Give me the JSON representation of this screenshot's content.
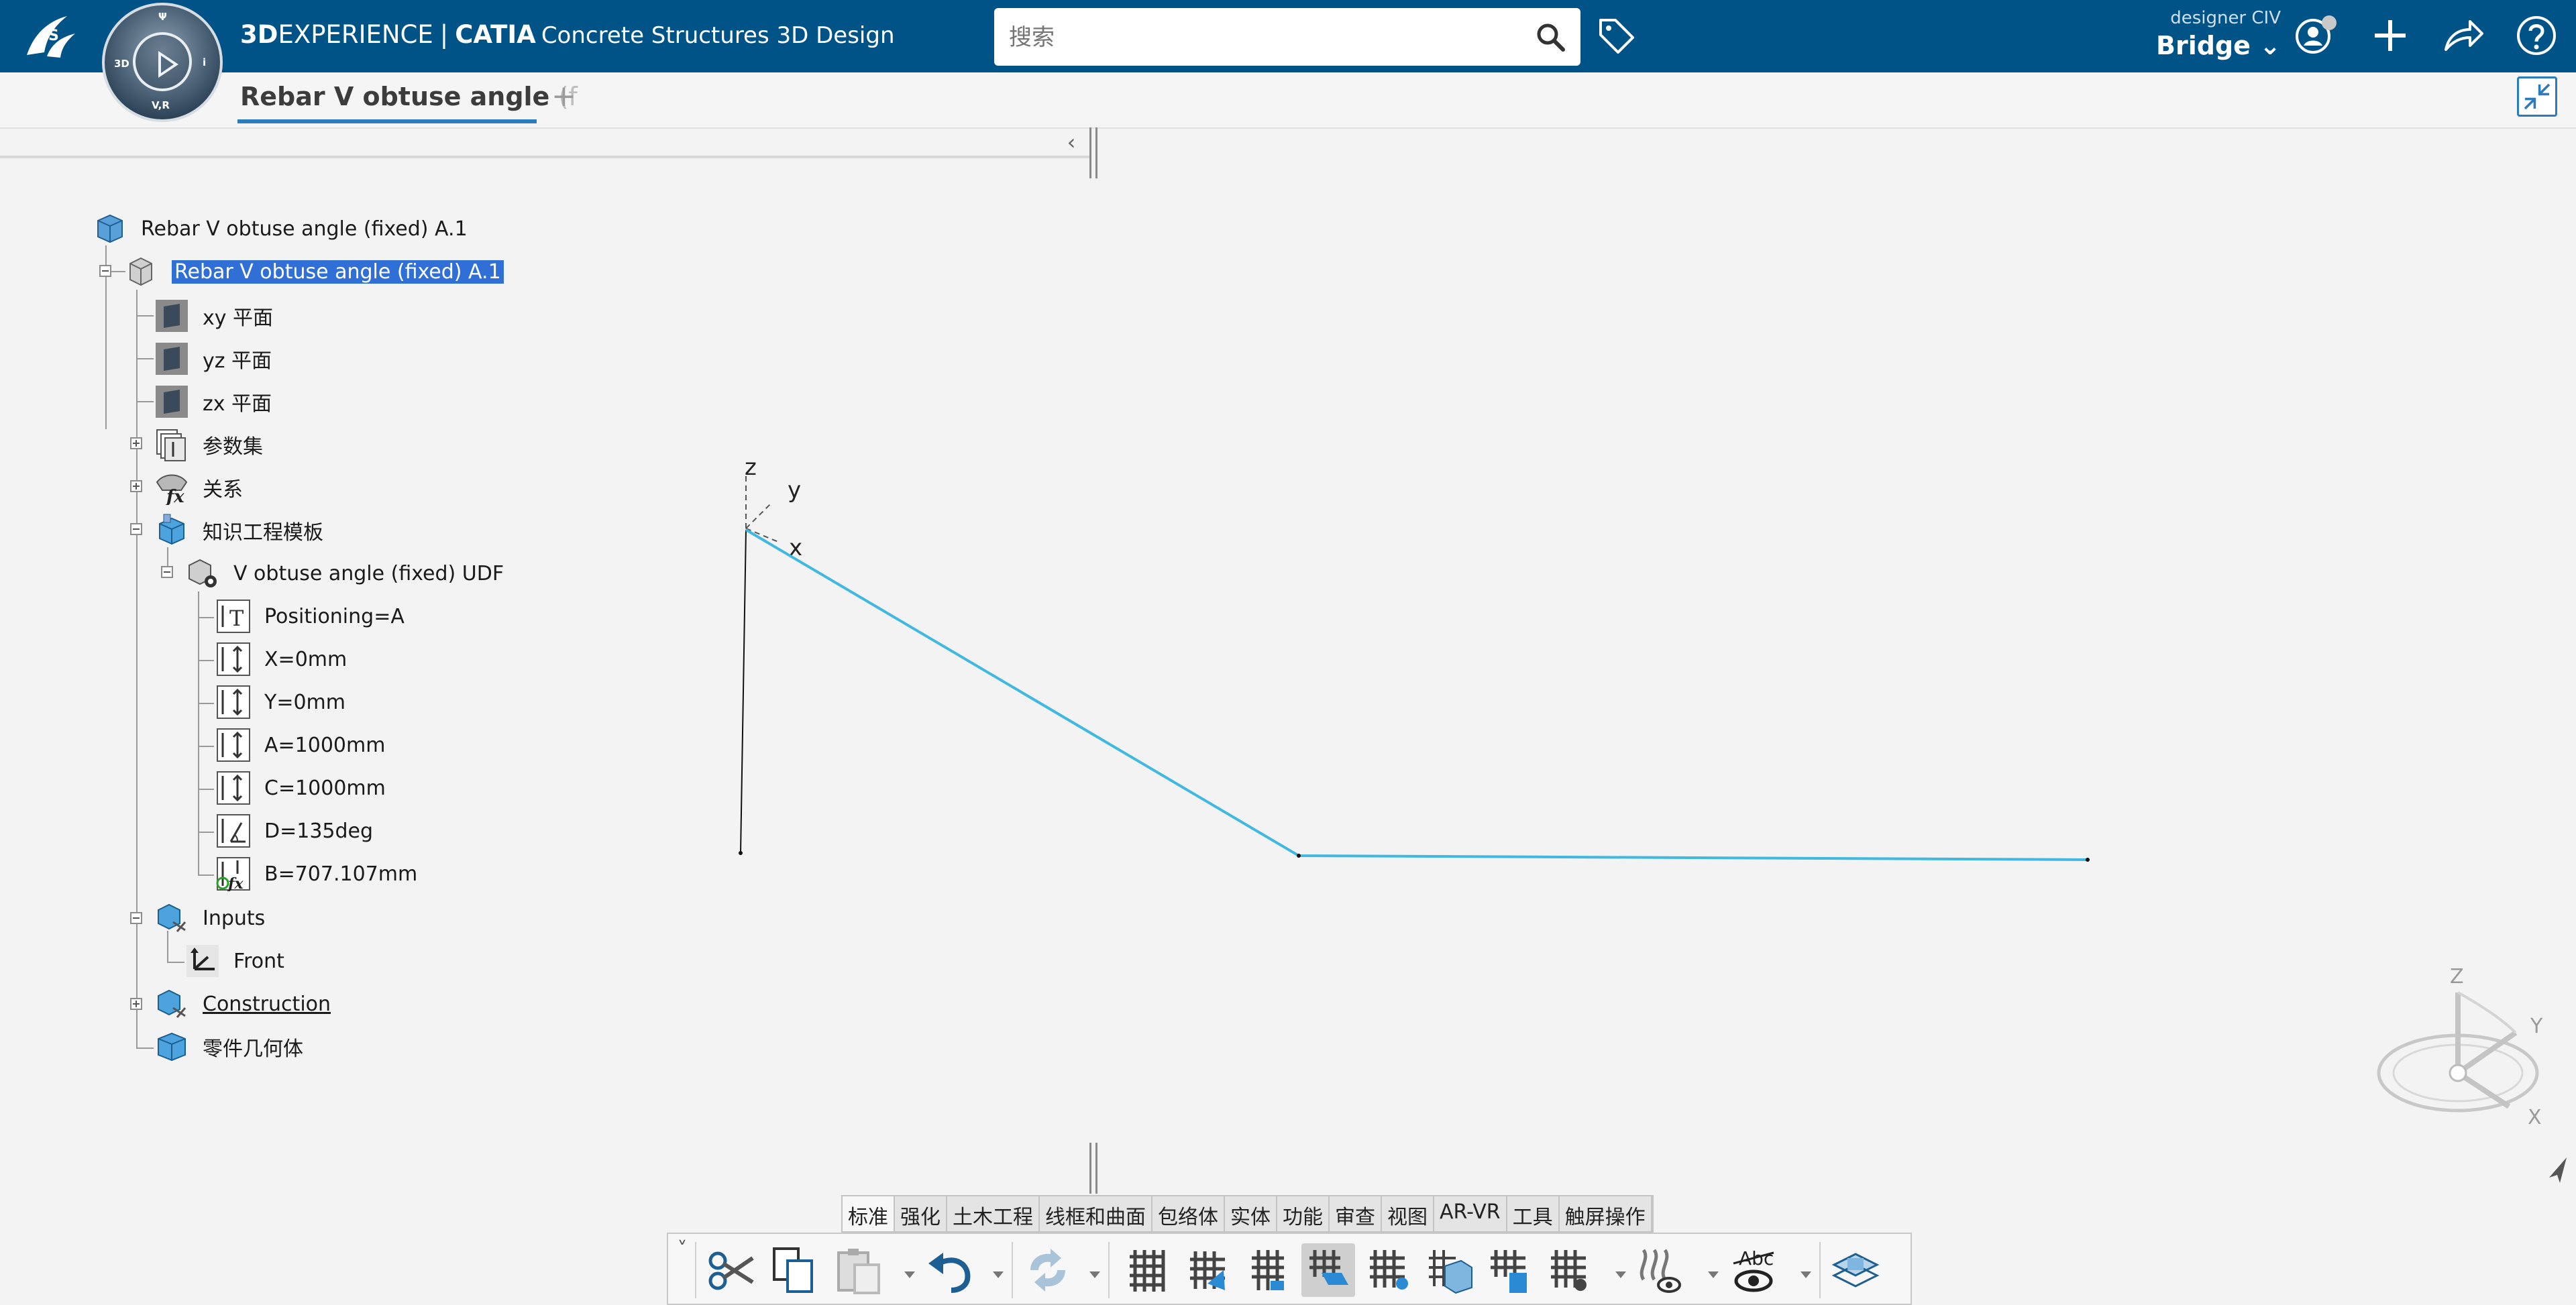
{
  "header": {
    "brand_3d": "3D",
    "brand_experience": "EXPERIENCE",
    "brand_separator": "|",
    "brand_catia": "CATIA",
    "brand_product": "Concrete Structures 3D Design",
    "search_placeholder": "搜索",
    "user_role": "designer CIV",
    "collab_space": "Bridge",
    "compass_labels": {
      "top": "Ψ",
      "left": "3D",
      "right": "i",
      "bottom": "V,R"
    }
  },
  "tabs": {
    "active_label": "Rebar V obtuse angle",
    "active_faded": "(f",
    "add_label": "+"
  },
  "panel": {
    "collapse_label": "‹"
  },
  "tree": {
    "root": "Rebar V obtuse angle (fixed) A.1",
    "part": "Rebar V obtuse angle (fixed) A.1",
    "planes": [
      "xy 平面",
      "yz 平面",
      "zx 平面"
    ],
    "parameters": "参数集",
    "relations": "关系",
    "kw_template": "知识工程模板",
    "udf": "V obtuse angle (fixed) UDF",
    "udf_params": [
      "Positioning=A",
      "X=0mm",
      "Y=0mm",
      "A=1000mm",
      "C=1000mm",
      "D=135deg",
      "B=707.107mm"
    ],
    "inputs": "Inputs",
    "front": "Front",
    "construction": "Construction",
    "part_body": "零件几何体"
  },
  "viewport": {
    "axis_labels": {
      "z": "z",
      "y": "y",
      "x": "x"
    },
    "compass_labels": {
      "z": "Z",
      "y": "Y",
      "x": "X"
    },
    "rebar_color": "#40b8e0"
  },
  "action_bar": {
    "tabs": [
      "标准",
      "强化",
      "土木工程",
      "线框和曲面",
      "包络体",
      "实体",
      "功能",
      "审查",
      "视图",
      "AR-VR",
      "工具",
      "触屏操作"
    ],
    "active_tab": "标准",
    "expand_label": "˅"
  },
  "colors": {
    "topbar": "#005386",
    "selection": "#2f6fd6",
    "accent": "#2b7bbd"
  }
}
